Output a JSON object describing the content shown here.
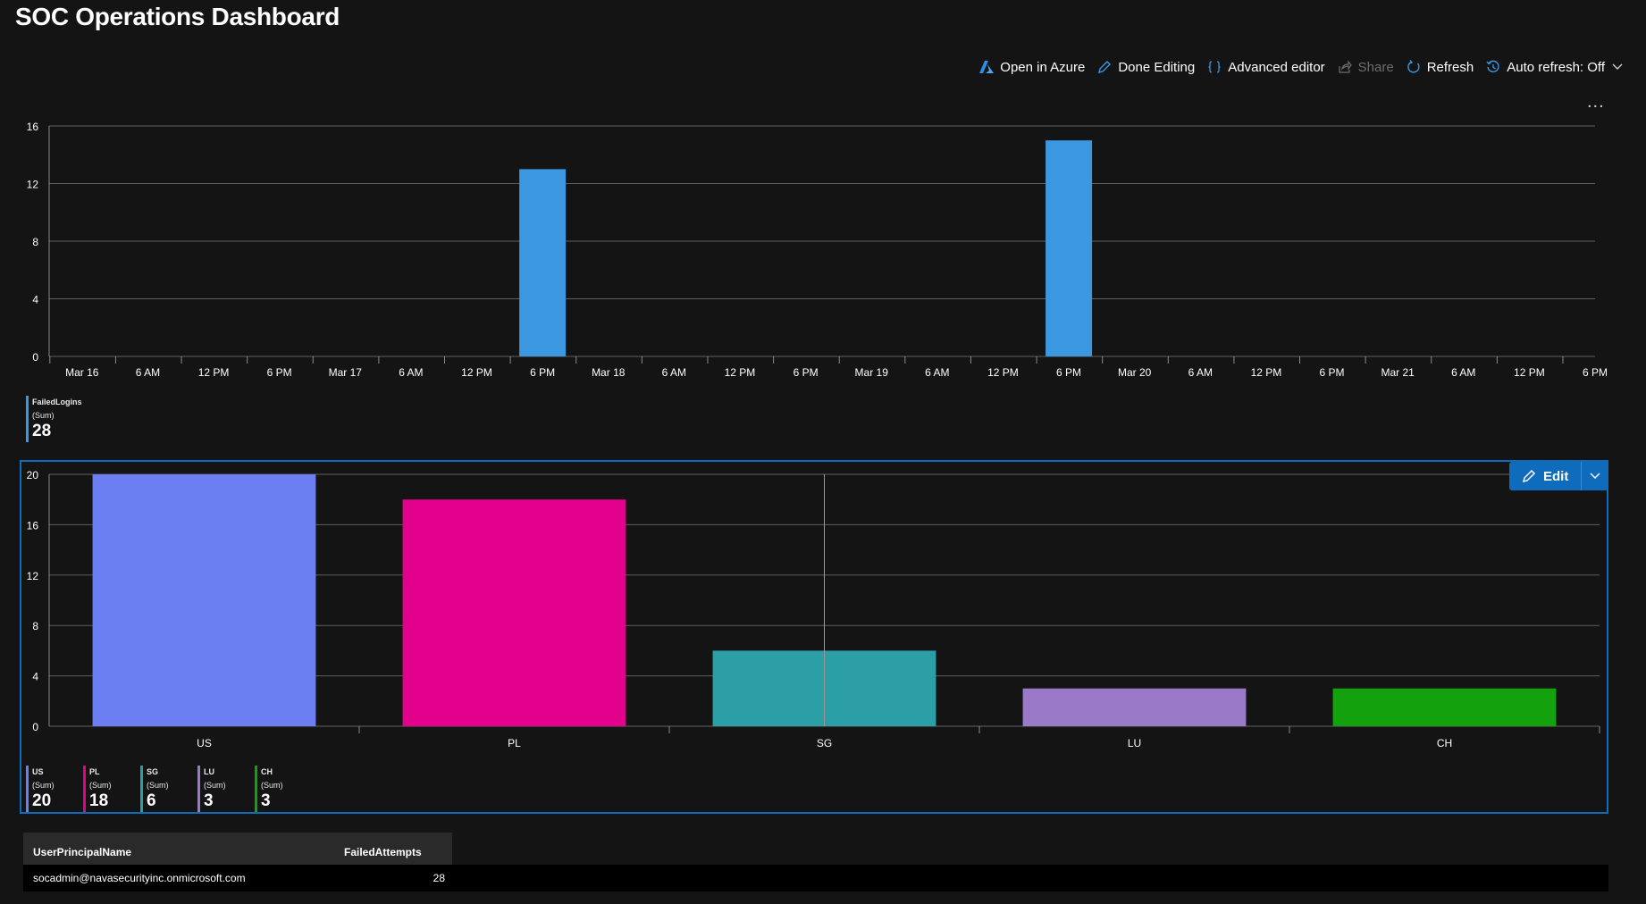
{
  "page_title": "SOC Operations Dashboard",
  "toolbar": {
    "open_in_azure": "Open in Azure",
    "done_editing": "Done Editing",
    "advanced_editor": "Advanced editor",
    "share": "Share",
    "refresh": "Refresh",
    "auto_refresh": "Auto refresh: Off"
  },
  "panel_menu": "...",
  "edit_button": "Edit",
  "colors": {
    "accent": "#0f6cbd",
    "failed_logins": "#3b97e0",
    "US": "#6b7ff2",
    "PL": "#e3008c",
    "SG": "#2c9fa6",
    "LU": "#9b79c9",
    "CH": "#13a10e"
  },
  "chart_data": [
    {
      "type": "bar",
      "x_tick_labels": [
        "Mar 16",
        "6 AM",
        "12 PM",
        "6 PM",
        "Mar 17",
        "6 AM",
        "12 PM",
        "6 PM",
        "Mar 18",
        "6 AM",
        "12 PM",
        "6 PM",
        "Mar 19",
        "6 AM",
        "12 PM",
        "6 PM",
        "Mar 20",
        "6 AM",
        "12 PM",
        "6 PM",
        "Mar 21",
        "6 AM",
        "12 PM",
        "6 PM"
      ],
      "x_range": [
        "Mar 15 9 PM",
        "Mar 21 6 PM"
      ],
      "series": [
        {
          "name": "FailedLogins",
          "aggregation": "(Sum)",
          "total": "28",
          "points": [
            {
              "x": "Mar 17 6 PM",
              "y": 13
            },
            {
              "x": "Mar 19 6 PM",
              "y": 15
            }
          ]
        }
      ],
      "y_ticks": [
        "0",
        "4",
        "8",
        "12",
        "16"
      ],
      "ylim": [
        0,
        16
      ],
      "grid": true,
      "legend_position": "bottom-left"
    },
    {
      "type": "bar",
      "categories": [
        "US",
        "PL",
        "SG",
        "LU",
        "CH"
      ],
      "values": [
        20,
        18,
        6,
        3,
        3
      ],
      "y_ticks": [
        "0",
        "4",
        "8",
        "12",
        "16",
        "20"
      ],
      "ylim": [
        0,
        20
      ],
      "grid": true,
      "legend_position": "bottom-left",
      "legend": [
        {
          "name": "US",
          "aggregation": "(Sum)",
          "value": "20"
        },
        {
          "name": "PL",
          "aggregation": "(Sum)",
          "value": "18"
        },
        {
          "name": "SG",
          "aggregation": "(Sum)",
          "value": "6"
        },
        {
          "name": "LU",
          "aggregation": "(Sum)",
          "value": "3"
        },
        {
          "name": "CH",
          "aggregation": "(Sum)",
          "value": "3"
        }
      ]
    }
  ],
  "table": {
    "columns": [
      "UserPrincipalName",
      "FailedAttempts"
    ],
    "rows": [
      [
        "socadmin@navasecurityinc.onmicrosoft.com",
        "28"
      ]
    ]
  }
}
